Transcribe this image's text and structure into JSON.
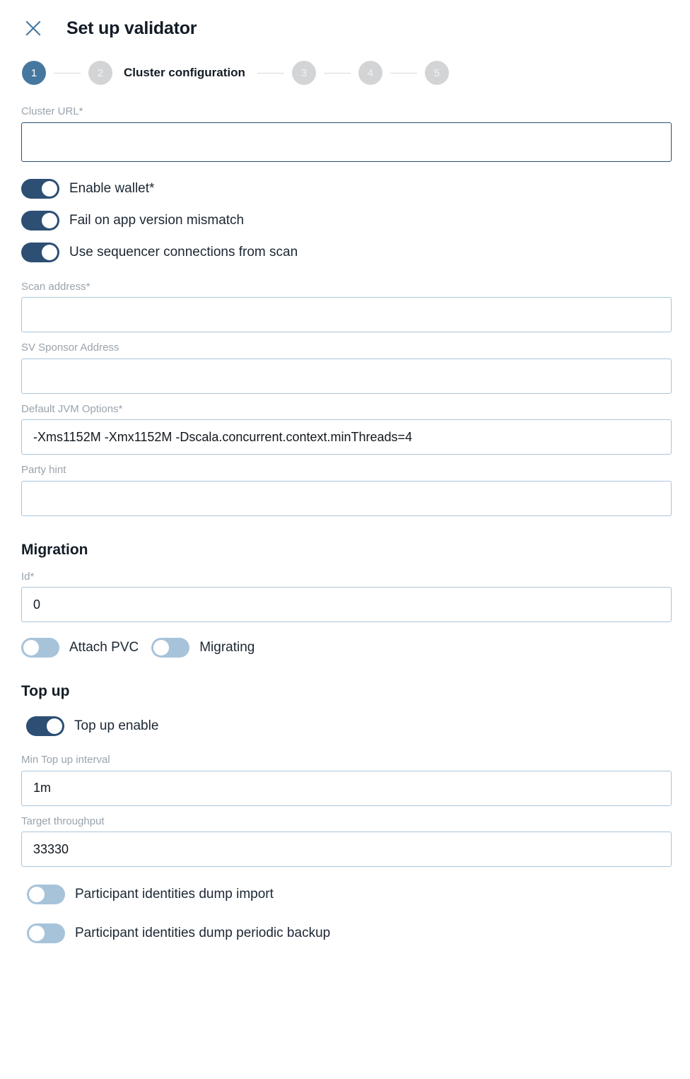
{
  "header": {
    "close_icon": "close-icon",
    "title": "Set up validator"
  },
  "stepper": {
    "current_step": 1,
    "active_color": "#46789f",
    "inactive_color": "#d3d4d6",
    "steps": [
      {
        "number": "1",
        "label": "",
        "state": "active"
      },
      {
        "number": "2",
        "label": "Cluster configuration",
        "state": "inactive"
      },
      {
        "number": "3",
        "label": "",
        "state": "inactive"
      },
      {
        "number": "4",
        "label": "",
        "state": "inactive"
      },
      {
        "number": "5",
        "label": "",
        "state": "inactive"
      }
    ]
  },
  "form": {
    "cluster_url": {
      "label": "Cluster URL*",
      "value": "",
      "placeholder": "",
      "focused": true
    },
    "enable_wallet": {
      "label": "Enable wallet*",
      "state": "on"
    },
    "fail_on_app_version_mismatch": {
      "label": "Fail on app version mismatch",
      "state": "on"
    },
    "use_sequencer_connections_from_scan": {
      "label": "Use sequencer connections from scan",
      "state": "on"
    },
    "scan_address": {
      "label": "Scan address*",
      "value": "",
      "placeholder": ""
    },
    "sv_sponsor_address": {
      "label": "SV Sponsor Address",
      "value": "",
      "placeholder": ""
    },
    "default_jvm_options": {
      "label": "Default JVM Options*",
      "value": "-Xms1152M -Xmx1152M -Dscala.concurrent.context.minThreads=4",
      "placeholder": ""
    },
    "party_hint": {
      "label": "Party hint",
      "value": "",
      "placeholder": ""
    }
  },
  "migration": {
    "section_title": "Migration",
    "id": {
      "label": "Id*",
      "value": "0",
      "placeholder": ""
    },
    "attach_pvc": {
      "label": "Attach PVC",
      "state": "off"
    },
    "migrating": {
      "label": "Migrating",
      "state": "off"
    }
  },
  "top_up": {
    "section_title": "Top up",
    "top_up_enable": {
      "label": "Top up enable",
      "state": "on"
    },
    "min_top_up_interval": {
      "label": "Min Top up interval",
      "value": "1m",
      "placeholder": ""
    },
    "target_throughput": {
      "label": "Target throughput",
      "value": "33330",
      "placeholder": ""
    }
  },
  "participant": {
    "dump_import": {
      "label": "Participant identities dump import",
      "state": "off"
    },
    "dump_periodic_backup": {
      "label": "Participant identities dump periodic backup",
      "state": "off"
    }
  },
  "colors": {
    "toggle_on": "#2c4f73",
    "toggle_off": "#a7c3da",
    "input_border": "#a9c5da",
    "input_border_focused": "#2c4f73",
    "accent": "#46789f",
    "label_text": "#9aa3ab",
    "body_text": "#1c2733"
  }
}
